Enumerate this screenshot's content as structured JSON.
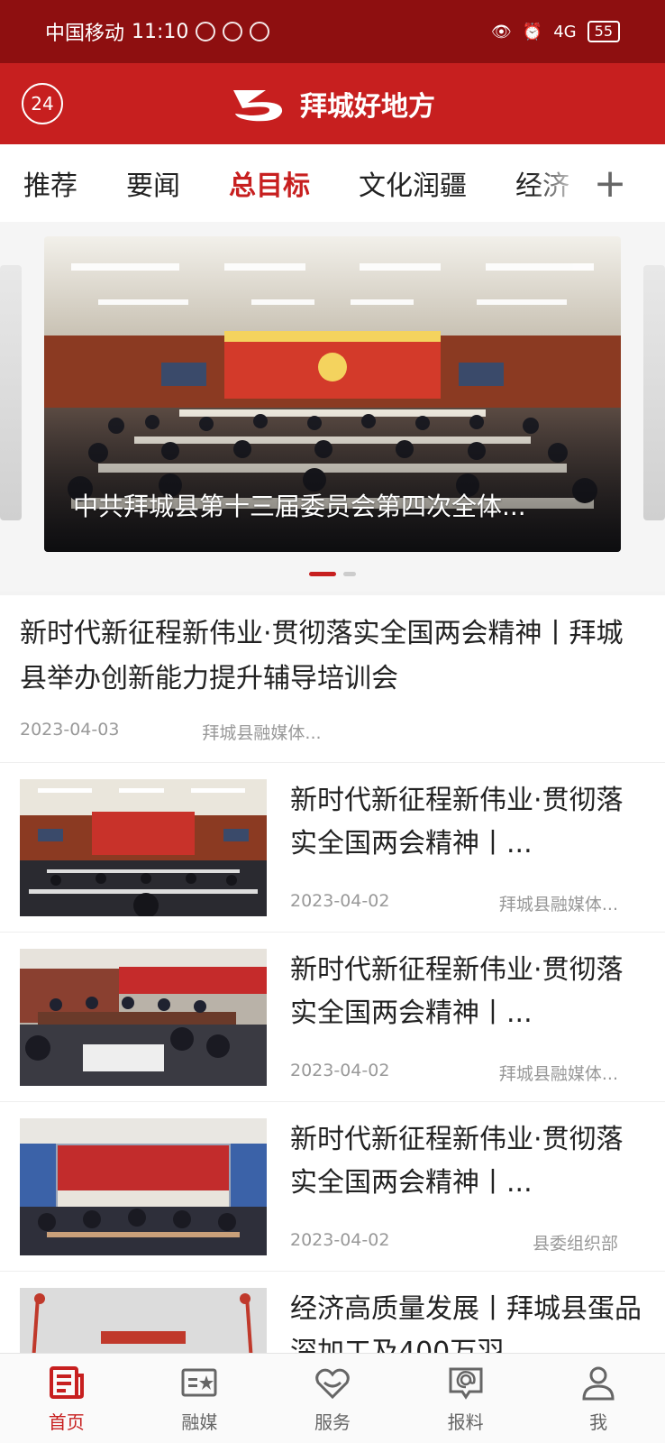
{
  "status_bar": {
    "carrier": "中国移动",
    "time": "11:10",
    "network": "4G",
    "battery": "55"
  },
  "header": {
    "badge": "24",
    "brand_name": "拜城好地方"
  },
  "tabs": [
    {
      "label": "推荐"
    },
    {
      "label": "要闻"
    },
    {
      "label": "总目标"
    },
    {
      "label": "文化润疆"
    },
    {
      "label": "经济"
    }
  ],
  "carousel": {
    "caption": "中共拜城县第十三届委员会第四次全体...",
    "slide_index": 1,
    "slide_count": 2
  },
  "articles": [
    {
      "title": "新时代新征程新伟业·贯彻落实全国两会精神丨拜城县举办创新能力提升辅导培训会",
      "date": "2023-04-03",
      "source": "拜城县融媒体..."
    },
    {
      "title": "新时代新征程新伟业·贯彻落实全国两会精神丨...",
      "date": "2023-04-02",
      "source": "拜城县融媒体..."
    },
    {
      "title": "新时代新征程新伟业·贯彻落实全国两会精神丨...",
      "date": "2023-04-02",
      "source": "拜城县融媒体..."
    },
    {
      "title": "新时代新征程新伟业·贯彻落实全国两会精神丨...",
      "date": "2023-04-02",
      "source": "县委组织部"
    },
    {
      "title": "经济高质量发展丨拜城县蛋品深加工及400万羽",
      "date": "",
      "source": ""
    }
  ],
  "bottom_nav": [
    {
      "label": "首页",
      "icon": "news-icon"
    },
    {
      "label": "融媒",
      "icon": "media-star-icon"
    },
    {
      "label": "服务",
      "icon": "heart-hands-icon"
    },
    {
      "label": "报料",
      "icon": "report-at-icon"
    },
    {
      "label": "我",
      "icon": "user-icon"
    }
  ],
  "colors": {
    "brand": "#c71f1f",
    "status_bar": "#8e0f10"
  }
}
